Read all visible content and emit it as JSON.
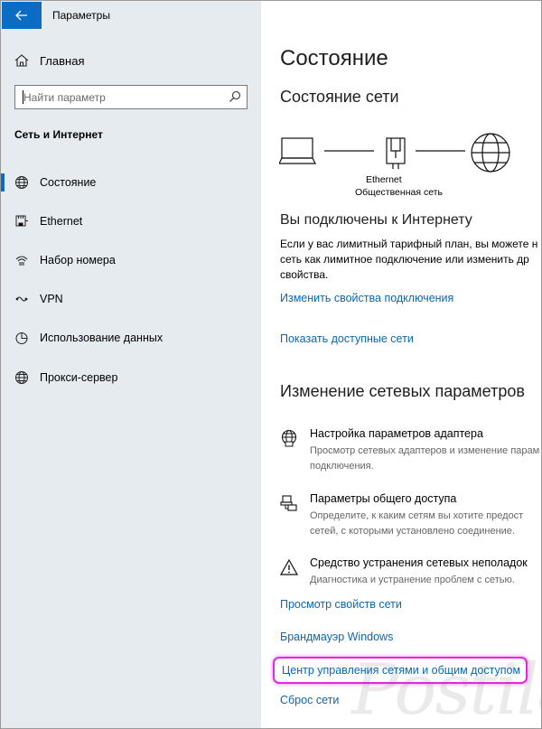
{
  "window": {
    "title": "Параметры"
  },
  "sidebar": {
    "home_label": "Главная",
    "search_placeholder": "Найти параметр",
    "section_title": "Сеть и Интернет",
    "items": [
      {
        "label": "Состояние",
        "icon": "globe-icon",
        "selected": true
      },
      {
        "label": "Ethernet",
        "icon": "ethernet-icon",
        "selected": false
      },
      {
        "label": "Набор номера",
        "icon": "dialup-icon",
        "selected": false
      },
      {
        "label": "VPN",
        "icon": "vpn-icon",
        "selected": false
      },
      {
        "label": "Использование данных",
        "icon": "data-usage-icon",
        "selected": false
      },
      {
        "label": "Прокси-сервер",
        "icon": "globe-icon",
        "selected": false
      }
    ]
  },
  "main": {
    "title": "Состояние",
    "network_status_heading": "Состояние сети",
    "diagram": {
      "adapter_label": "Ethernet",
      "network_label": "Общественная сеть"
    },
    "connected_heading": "Вы подключены к Интернету",
    "connected_text": [
      "Если у вас лимитный тарифный план, вы можете н",
      "сеть как лимитное подключение или изменить др",
      "свойства."
    ],
    "links": {
      "change_connection_props": "Изменить свойства подключения",
      "show_available_networks": "Показать доступные сети"
    },
    "change_settings_heading": "Изменение сетевых параметров",
    "options": [
      {
        "title": "Настройка параметров адаптера",
        "desc": [
          "Просмотр сетевых адаптеров и изменение парам",
          "подключения."
        ],
        "icon": "adapter-icon"
      },
      {
        "title": "Параметры общего доступа",
        "desc": [
          "Определите, к каким сетям вы хотите предост",
          "сетей, с которыми установлено соединение."
        ],
        "icon": "sharing-icon"
      },
      {
        "title": "Средство устранения сетевых неполадок",
        "desc": [
          "Диагностика и устранение проблем с сетью."
        ],
        "icon": "warning-icon"
      }
    ],
    "bottom_links": {
      "view_network_properties": "Просмотр свойств сети",
      "firewall": "Брандмауэр Windows",
      "network_sharing_center": "Центр управления сетями и общим доступом",
      "network_reset": "Сброс сети"
    }
  },
  "colors": {
    "accent": "#0a6cc2",
    "link": "#0b67b3",
    "sidebar_bg": "#e6ebef",
    "highlight": "#e02ae0"
  },
  "watermark": "Postila.ru"
}
